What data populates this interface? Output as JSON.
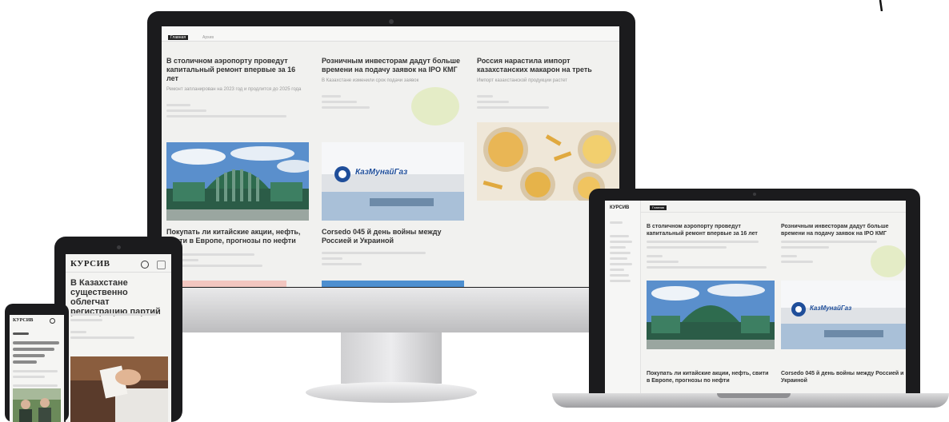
{
  "imac": {
    "tabs": [
      "Главная",
      "Архив"
    ],
    "articles": [
      {
        "title": "В столичном аэропорту проведут капитальный ремонт впервые за 16 лет",
        "lead": "Ремонт запланирован на 2023 год и продлится до 2025 года"
      },
      {
        "title": "Розничным инвесторам дадут больше времени на подачу заявок на IPO КМГ",
        "lead": "В Казахстане изменили срок подачи заявок"
      },
      {
        "title": "Россия нарастила импорт казахстанских макарон на треть",
        "lead": "Импорт казахстанской продукции растет"
      },
      {
        "title": "Покупать ли китайские акции, нефть, свити в Европе, прогнозы по нефти",
        "lead": ""
      },
      {
        "title": "Cоrsedo 045 й день войны между Россией и Украиной",
        "lead": ""
      }
    ],
    "logo_text": "КазМунайГаз"
  },
  "laptop": {
    "logo": "КУРСИВ",
    "tab": "Главная",
    "articles": [
      {
        "title": "В столичном аэропорту проведут капитальный ремонт впервые за 16 лет",
        "lead": ""
      },
      {
        "title": "Розничным инвесторам дадут больше времени на подачу заявок на IPO КМГ",
        "lead": ""
      },
      {
        "title": "Покупать ли китайские акции, нефть, свити в Европе, прогнозы по нефти",
        "lead": ""
      },
      {
        "title": "Cоrsedo 045 й день войны между Россией и Украиной",
        "lead": ""
      }
    ],
    "logo_text": "КазМунайГаз"
  },
  "tablet": {
    "logo": "КУРСИВ",
    "title": "В Казахстане существенно облегчат регистрацию партий",
    "lead": ""
  },
  "phone": {
    "logo": "КУРСИВ"
  },
  "colors": {
    "bezel": "#1b1b1d",
    "screen_bg": "#f1f1ef",
    "sky": "#4f86c6",
    "building_green": "#2e6b4e",
    "pasta": "#e6b34a",
    "accent_green": "#e4ecc6"
  }
}
